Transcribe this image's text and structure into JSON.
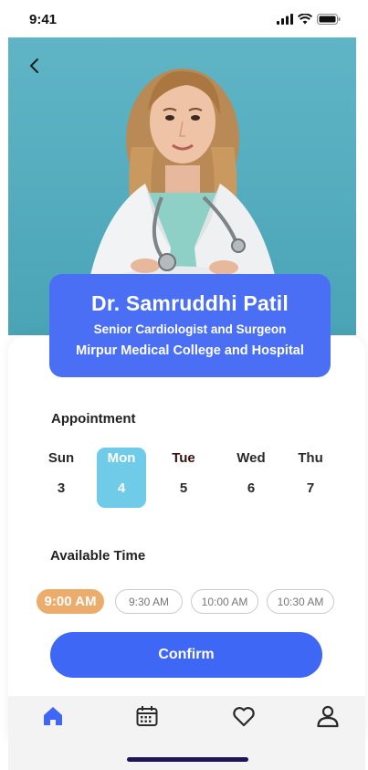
{
  "status_bar": {
    "time": "9:41"
  },
  "doctor": {
    "name": "Dr. Samruddhi Patil",
    "title": "Senior Cardiologist and Surgeon",
    "hospital": "Mirpur Medical College and Hospital"
  },
  "appointment": {
    "heading": "Appointment",
    "days": [
      {
        "name": "Sun",
        "date": "3"
      },
      {
        "name": "Mon",
        "date": "4"
      },
      {
        "name": "Tue",
        "date": "5"
      },
      {
        "name": "Wed",
        "date": "6"
      },
      {
        "name": "Thu",
        "date": "7"
      }
    ],
    "selected_day": "Mon"
  },
  "available_time": {
    "heading": "Available Time",
    "slots": [
      "9:00 AM",
      "9:30 AM",
      "10:00 AM",
      "10:30 AM"
    ],
    "selected_slot": "9:00 AM"
  },
  "confirm_label": "Confirm",
  "nav": {
    "items": [
      {
        "icon": "home-icon",
        "active": true
      },
      {
        "icon": "calendar-icon",
        "active": false
      },
      {
        "icon": "heart-icon",
        "active": false
      },
      {
        "icon": "profile-icon",
        "active": false
      }
    ]
  },
  "colors": {
    "primary": "#3f67f6",
    "doctor_card": "#4a6ff5",
    "selected_day": "#6fcbe8",
    "selected_time": "#ecac6c",
    "hero_bg": "#5fb5c6"
  }
}
